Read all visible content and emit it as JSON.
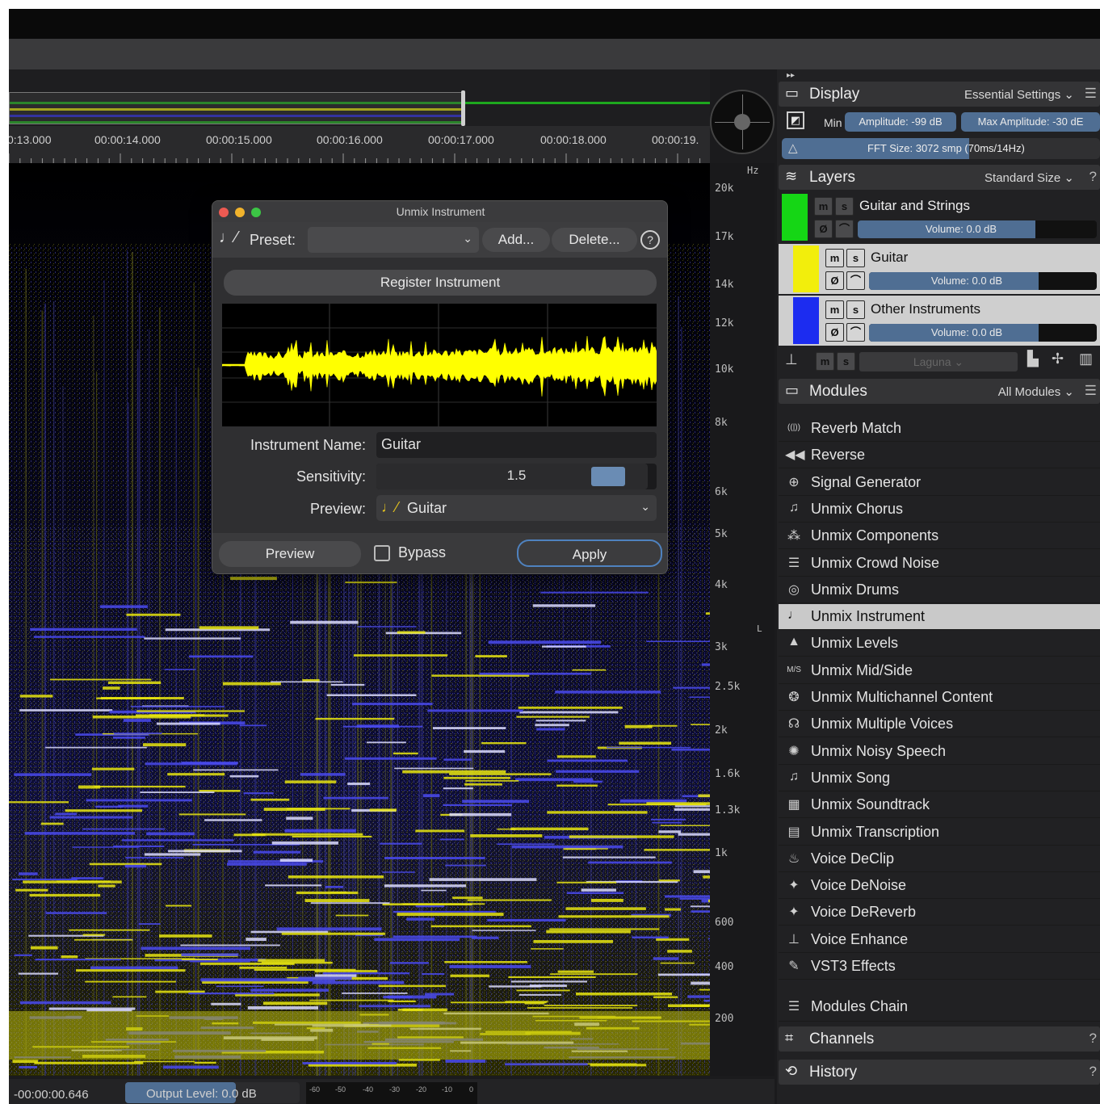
{
  "timeline": {
    "labels": [
      "0:13.000",
      "00:00:14.000",
      "00:00:15.000",
      "00:00:16.000",
      "00:00:17.000",
      "00:00:18.000",
      "00:00:19."
    ]
  },
  "frequency_axis": {
    "unit": "Hz",
    "labels": [
      "20k",
      "17k",
      "14k",
      "12k",
      "10k",
      "8k",
      "6k",
      "5k",
      "4k",
      "3k",
      "2.5k",
      "2k",
      "1.6k",
      "1.3k",
      "1k",
      "600",
      "400",
      "200"
    ],
    "channel_marker": "L"
  },
  "dialog": {
    "title": "Unmix Instrument",
    "preset_label": "Preset:",
    "preset_value": "",
    "add_label": "Add...",
    "delete_label": "Delete...",
    "help_glyph": "?",
    "register_label": "Register Instrument",
    "instrument_name_label": "Instrument Name:",
    "instrument_name_value": "Guitar",
    "sensitivity_label": "Sensitivity:",
    "sensitivity_value": "1.5",
    "preview_label": "Preview:",
    "preview_value": "Guitar",
    "preview_button": "Preview",
    "bypass_label": "Bypass",
    "apply_label": "Apply"
  },
  "display": {
    "title": "Display",
    "mode": "Essential Settings",
    "min_label": "Min",
    "min_amplitude": "Amplitude: -99 dB",
    "max_amplitude": "Max Amplitude: -30 dE",
    "fft": "FFT Size: 3072 smp (70ms/14Hz)"
  },
  "layers": {
    "title": "Layers",
    "size": "Standard Size",
    "items": [
      {
        "name": "Guitar and Strings",
        "volume": "Volume: 0.0 dB",
        "color": "#15d615",
        "m": "m",
        "s": "s"
      },
      {
        "name": "Guitar",
        "volume": "Volume: 0.0 dB",
        "color": "#f2ee0c",
        "m": "m",
        "s": "s"
      },
      {
        "name": "Other Instruments",
        "volume": "Volume: 0.0 dB",
        "color": "#1c2cf0",
        "m": "m",
        "s": "s"
      }
    ],
    "footer_name": "Laguna",
    "footer_m": "m",
    "footer_s": "s"
  },
  "modules": {
    "title": "Modules",
    "filter": "All Modules",
    "items": [
      {
        "label": "Reverb Match",
        "icon": "reverb-match-icon",
        "glyph": "((|))"
      },
      {
        "label": "Reverse",
        "icon": "reverse-icon",
        "glyph": "◀◀"
      },
      {
        "label": "Signal Generator",
        "icon": "signal-generator-icon",
        "glyph": "⊕"
      },
      {
        "label": "Unmix Chorus",
        "icon": "unmix-chorus-icon",
        "glyph": "♫"
      },
      {
        "label": "Unmix Components",
        "icon": "unmix-components-icon",
        "glyph": "⁂"
      },
      {
        "label": "Unmix Crowd Noise",
        "icon": "unmix-crowd-noise-icon",
        "glyph": "☰"
      },
      {
        "label": "Unmix Drums",
        "icon": "unmix-drums-icon",
        "glyph": "◎"
      },
      {
        "label": "Unmix Instrument",
        "icon": "unmix-instrument-icon",
        "glyph": "♩"
      },
      {
        "label": "Unmix Levels",
        "icon": "unmix-levels-icon",
        "glyph": "▲"
      },
      {
        "label": "Unmix Mid/Side",
        "icon": "unmix-mid-side-icon",
        "glyph": "M/S"
      },
      {
        "label": "Unmix Multichannel Content",
        "icon": "unmix-multichannel-icon",
        "glyph": "❂"
      },
      {
        "label": "Unmix Multiple Voices",
        "icon": "unmix-multiple-voices-icon",
        "glyph": "☊"
      },
      {
        "label": "Unmix Noisy Speech",
        "icon": "unmix-noisy-speech-icon",
        "glyph": "✺"
      },
      {
        "label": "Unmix Song",
        "icon": "unmix-song-icon",
        "glyph": "♫"
      },
      {
        "label": "Unmix Soundtrack",
        "icon": "unmix-soundtrack-icon",
        "glyph": "▦"
      },
      {
        "label": "Unmix Transcription",
        "icon": "unmix-transcription-icon",
        "glyph": "▤"
      },
      {
        "label": "Voice DeClip",
        "icon": "voice-declip-icon",
        "glyph": "♨"
      },
      {
        "label": "Voice DeNoise",
        "icon": "voice-denoise-icon",
        "glyph": "✦"
      },
      {
        "label": "Voice DeReverb",
        "icon": "voice-dereverb-icon",
        "glyph": "✦"
      },
      {
        "label": "Voice Enhance",
        "icon": "voice-enhance-icon",
        "glyph": "⊥"
      },
      {
        "label": "VST3 Effects",
        "icon": "vst3-effects-icon",
        "glyph": "✎"
      }
    ],
    "selected": "Unmix Instrument",
    "chain": "Modules Chain"
  },
  "channels": {
    "title": "Channels"
  },
  "history": {
    "title": "History"
  },
  "status": {
    "time": "-00:00:00.646",
    "output_label": "Output Level:",
    "output_value": "0.0 dB",
    "meter_labels": [
      "-60",
      "-50",
      "-40",
      "-30",
      "-20",
      "-10",
      "0"
    ]
  }
}
